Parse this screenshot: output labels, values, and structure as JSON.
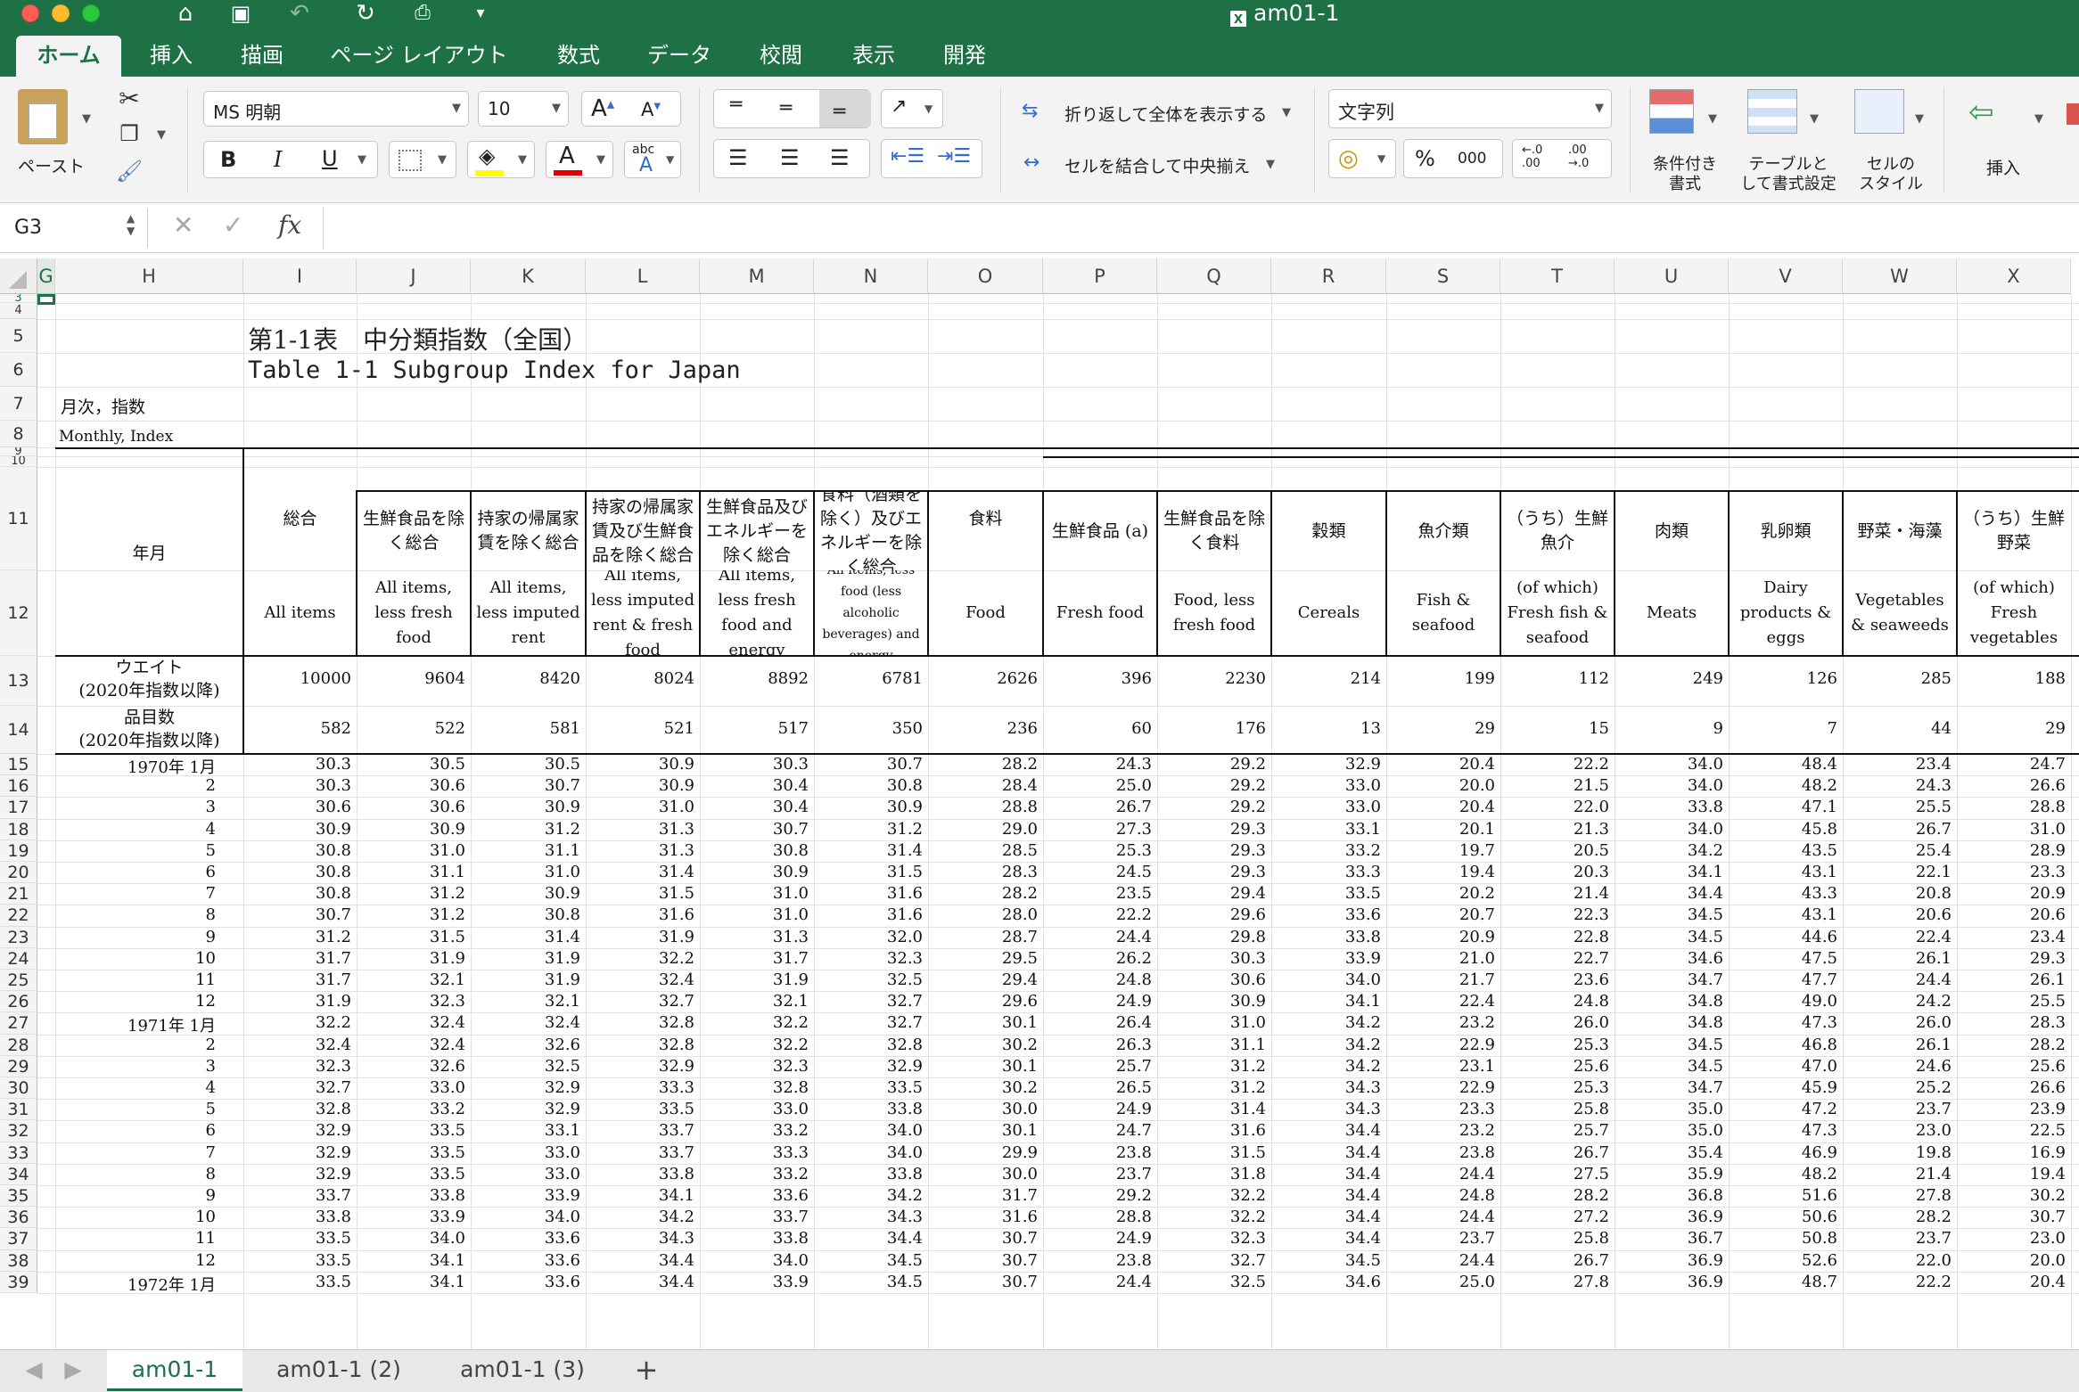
{
  "window": {
    "title": "am01-1"
  },
  "tabs": [
    "ホーム",
    "挿入",
    "描画",
    "ページ レイアウト",
    "数式",
    "データ",
    "校閲",
    "表示",
    "開発"
  ],
  "ribbon": {
    "paste_label": "ペースト",
    "font_name": "MS 明朝",
    "font_size": "10",
    "wrap_label": "折り返して全体を表示する",
    "merge_label": "セルを結合して中央揃え",
    "number_format": "文字列",
    "thousands": "000",
    "cond_format": [
      "条件付き",
      "書式"
    ],
    "table_format": [
      "テーブルと",
      "して書式設定"
    ],
    "cell_style": [
      "セルの",
      "スタイル"
    ],
    "insert_label": "挿入"
  },
  "formula_bar": {
    "name_box": "G3",
    "fx": "fx",
    "value": ""
  },
  "columns": [
    "G",
    "H",
    "I",
    "J",
    "K",
    "L",
    "M",
    "N",
    "O",
    "P",
    "Q",
    "R",
    "S",
    "T",
    "U",
    "V",
    "W",
    "X"
  ],
  "sheet": {
    "title_ja": "第1-1表　中分類指数（全国）",
    "title_en": "Table 1-1 Subgroup Index for Japan",
    "label_ja": "月次，指数",
    "label_en": "Monthly, Index",
    "year_month_label": "年月",
    "header_ja": [
      "総合",
      "生鮮食品を除く総合",
      "持家の帰属家賃を除く総合",
      "持家の帰属家賃及び生鮮食品を除く総合",
      "生鮮食品及びエネルギーを除く総合",
      "食料（酒類を除く）及びエネルギーを除く総合",
      "食料",
      "生鮮食品 (a)",
      "生鮮食品を除く食料",
      "穀類",
      "魚介類",
      "（うち）生鮮魚介",
      "肉類",
      "乳卵類",
      "野菜・海藻",
      "（うち）生鮮野菜"
    ],
    "header_en": [
      "All items",
      "All items, less fresh food",
      "All items, less imputed rent",
      "All items, less imputed rent & fresh food",
      "All items, less fresh food and energy",
      "All items, less food (less alcoholic beverages) and energy",
      "Food",
      "Fresh food",
      "Food, less fresh food",
      "Cereals",
      "Fish & seafood",
      "(of which) Fresh fish & seafood",
      "Meats",
      "Dairy products & eggs",
      "Vegetables & seaweeds",
      "(of which) Fresh vegetables"
    ],
    "weight_label": [
      "ウエイト",
      "(2020年指数以降)"
    ],
    "weights": [
      "10000",
      "9604",
      "8420",
      "8024",
      "8892",
      "6781",
      "2626",
      "396",
      "2230",
      "214",
      "199",
      "112",
      "249",
      "126",
      "285",
      "188"
    ],
    "items_label": [
      "品目数",
      "(2020年指数以降)"
    ],
    "items": [
      "582",
      "522",
      "581",
      "521",
      "517",
      "350",
      "236",
      "60",
      "176",
      "13",
      "29",
      "15",
      "9",
      "7",
      "44",
      "29"
    ],
    "data_rows": [
      {
        "label": "1970年  1月",
        "v": [
          "30.3",
          "30.5",
          "30.5",
          "30.9",
          "30.3",
          "30.7",
          "28.2",
          "24.3",
          "29.2",
          "32.9",
          "20.4",
          "22.2",
          "34.0",
          "48.4",
          "23.4",
          "24.7"
        ]
      },
      {
        "label": "2",
        "v": [
          "30.3",
          "30.6",
          "30.7",
          "30.9",
          "30.4",
          "30.8",
          "28.4",
          "25.0",
          "29.2",
          "33.0",
          "20.0",
          "21.5",
          "34.0",
          "48.2",
          "24.3",
          "26.6"
        ]
      },
      {
        "label": "3",
        "v": [
          "30.6",
          "30.6",
          "30.9",
          "31.0",
          "30.4",
          "30.9",
          "28.8",
          "26.7",
          "29.2",
          "33.0",
          "20.4",
          "22.0",
          "33.8",
          "47.1",
          "25.5",
          "28.8"
        ]
      },
      {
        "label": "4",
        "v": [
          "30.9",
          "30.9",
          "31.2",
          "31.3",
          "30.7",
          "31.2",
          "29.0",
          "27.3",
          "29.3",
          "33.1",
          "20.1",
          "21.3",
          "34.0",
          "45.8",
          "26.7",
          "31.0"
        ]
      },
      {
        "label": "5",
        "v": [
          "30.8",
          "31.0",
          "31.1",
          "31.3",
          "30.8",
          "31.4",
          "28.5",
          "25.3",
          "29.3",
          "33.2",
          "19.7",
          "20.5",
          "34.2",
          "43.5",
          "25.4",
          "28.9"
        ]
      },
      {
        "label": "6",
        "v": [
          "30.8",
          "31.1",
          "31.0",
          "31.4",
          "30.9",
          "31.5",
          "28.3",
          "24.5",
          "29.3",
          "33.3",
          "19.4",
          "20.3",
          "34.1",
          "43.1",
          "22.1",
          "23.3"
        ]
      },
      {
        "label": "7",
        "v": [
          "30.8",
          "31.2",
          "30.9",
          "31.5",
          "31.0",
          "31.6",
          "28.2",
          "23.5",
          "29.4",
          "33.5",
          "20.2",
          "21.4",
          "34.4",
          "43.3",
          "20.8",
          "20.9"
        ]
      },
      {
        "label": "8",
        "v": [
          "30.7",
          "31.2",
          "30.8",
          "31.6",
          "31.0",
          "31.6",
          "28.0",
          "22.2",
          "29.6",
          "33.6",
          "20.7",
          "22.3",
          "34.5",
          "43.1",
          "20.6",
          "20.6"
        ]
      },
      {
        "label": "9",
        "v": [
          "31.2",
          "31.5",
          "31.4",
          "31.9",
          "31.3",
          "32.0",
          "28.7",
          "24.4",
          "29.8",
          "33.8",
          "20.9",
          "22.8",
          "34.5",
          "44.6",
          "22.4",
          "23.4"
        ]
      },
      {
        "label": "10",
        "v": [
          "31.7",
          "31.9",
          "31.9",
          "32.2",
          "31.7",
          "32.3",
          "29.5",
          "26.2",
          "30.3",
          "33.9",
          "21.0",
          "22.7",
          "34.6",
          "47.5",
          "26.1",
          "29.3"
        ]
      },
      {
        "label": "11",
        "v": [
          "31.7",
          "32.1",
          "31.9",
          "32.4",
          "31.9",
          "32.5",
          "29.4",
          "24.8",
          "30.6",
          "34.0",
          "21.7",
          "23.6",
          "34.7",
          "47.7",
          "24.4",
          "26.1"
        ]
      },
      {
        "label": "12",
        "v": [
          "31.9",
          "32.3",
          "32.1",
          "32.7",
          "32.1",
          "32.7",
          "29.6",
          "24.9",
          "30.9",
          "34.1",
          "22.4",
          "24.8",
          "34.8",
          "49.0",
          "24.2",
          "25.5"
        ]
      },
      {
        "label": "1971年  1月",
        "v": [
          "32.2",
          "32.4",
          "32.4",
          "32.8",
          "32.2",
          "32.7",
          "30.1",
          "26.4",
          "31.0",
          "34.2",
          "23.2",
          "26.0",
          "34.8",
          "47.3",
          "26.0",
          "28.3"
        ]
      },
      {
        "label": "2",
        "v": [
          "32.4",
          "32.4",
          "32.6",
          "32.8",
          "32.2",
          "32.8",
          "30.2",
          "26.3",
          "31.1",
          "34.2",
          "22.9",
          "25.3",
          "34.5",
          "46.8",
          "26.1",
          "28.2"
        ]
      },
      {
        "label": "3",
        "v": [
          "32.3",
          "32.6",
          "32.5",
          "32.9",
          "32.3",
          "32.9",
          "30.1",
          "25.7",
          "31.2",
          "34.2",
          "23.1",
          "25.6",
          "34.5",
          "47.0",
          "24.6",
          "25.6"
        ]
      },
      {
        "label": "4",
        "v": [
          "32.7",
          "33.0",
          "32.9",
          "33.3",
          "32.8",
          "33.5",
          "30.2",
          "26.5",
          "31.2",
          "34.3",
          "22.9",
          "25.3",
          "34.7",
          "45.9",
          "25.2",
          "26.6"
        ]
      },
      {
        "label": "5",
        "v": [
          "32.8",
          "33.2",
          "32.9",
          "33.5",
          "33.0",
          "33.8",
          "30.0",
          "24.9",
          "31.4",
          "34.3",
          "23.3",
          "25.8",
          "35.0",
          "47.2",
          "23.7",
          "23.9"
        ]
      },
      {
        "label": "6",
        "v": [
          "32.9",
          "33.5",
          "33.1",
          "33.7",
          "33.2",
          "34.0",
          "30.1",
          "24.7",
          "31.6",
          "34.4",
          "23.2",
          "25.7",
          "35.0",
          "47.3",
          "23.0",
          "22.5"
        ]
      },
      {
        "label": "7",
        "v": [
          "32.9",
          "33.5",
          "33.0",
          "33.7",
          "33.3",
          "34.0",
          "29.9",
          "23.8",
          "31.5",
          "34.4",
          "23.8",
          "26.7",
          "35.4",
          "46.9",
          "19.8",
          "16.9"
        ]
      },
      {
        "label": "8",
        "v": [
          "32.9",
          "33.5",
          "33.0",
          "33.8",
          "33.2",
          "33.8",
          "30.0",
          "23.7",
          "31.8",
          "34.4",
          "24.4",
          "27.5",
          "35.9",
          "48.2",
          "21.4",
          "19.4"
        ]
      },
      {
        "label": "9",
        "v": [
          "33.7",
          "33.8",
          "33.9",
          "34.1",
          "33.6",
          "34.2",
          "31.7",
          "29.2",
          "32.2",
          "34.4",
          "24.8",
          "28.2",
          "36.8",
          "51.6",
          "27.8",
          "30.2"
        ]
      },
      {
        "label": "10",
        "v": [
          "33.8",
          "33.9",
          "34.0",
          "34.2",
          "33.7",
          "34.3",
          "31.6",
          "28.8",
          "32.2",
          "34.4",
          "24.4",
          "27.2",
          "36.9",
          "50.6",
          "28.2",
          "30.7"
        ]
      },
      {
        "label": "11",
        "v": [
          "33.5",
          "34.0",
          "33.6",
          "34.3",
          "33.8",
          "34.4",
          "30.7",
          "24.9",
          "32.3",
          "34.4",
          "23.7",
          "25.8",
          "36.7",
          "50.8",
          "23.7",
          "23.0"
        ]
      },
      {
        "label": "12",
        "v": [
          "33.5",
          "34.1",
          "33.6",
          "34.4",
          "34.0",
          "34.5",
          "30.7",
          "23.8",
          "32.7",
          "34.5",
          "24.4",
          "26.7",
          "36.9",
          "52.6",
          "22.0",
          "20.0"
        ]
      },
      {
        "label": "1972年  1月",
        "v": [
          "33.5",
          "34.1",
          "33.6",
          "34.4",
          "33.9",
          "34.5",
          "30.7",
          "24.4",
          "32.5",
          "34.6",
          "25.0",
          "27.8",
          "36.9",
          "48.7",
          "22.2",
          "20.4"
        ]
      }
    ]
  },
  "sheet_tabs": [
    "am01-1",
    "am01-1 (2)",
    "am01-1 (3)"
  ]
}
